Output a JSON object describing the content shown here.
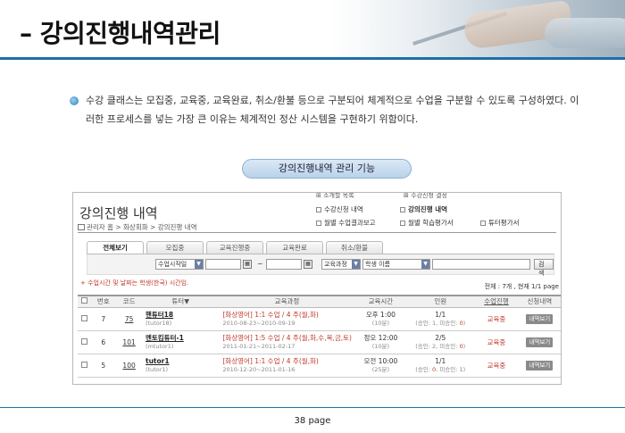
{
  "slide": {
    "title": "– 강의진행내역관리",
    "description": "수강 클래스는 모집중, 교육중, 교육완료, 취소/환불 등으로 구분되어 체계적으로 수업을 구분할 수 있도록 구성하였다. 이러한 프로세스를 넣는 가장 큰 이유는 체계적인 정산 시스템을 구현하기 위함이다.",
    "pill_label": "강의진행내역 관리 기능",
    "page_label": "38 page"
  },
  "app": {
    "menu_top": [
      "소개할 목록",
      "수강신청 결정"
    ],
    "menu": [
      {
        "label": "수강신청 내역"
      },
      {
        "label": "강의진행 내역"
      },
      {
        "label": "월별 수업결과보고"
      },
      {
        "label": "월별 학습평가서"
      },
      {
        "label": "튜터평가서"
      }
    ],
    "title": "강의진행 내역",
    "breadcrumb": "관리자 홈 > 화상회화 > 강의진행 내역",
    "tabs": [
      "전체보기",
      "모집중",
      "교육진행중",
      "교육완료",
      "취소/환불"
    ],
    "active_tab": 0,
    "search": {
      "date_select": "수업시작일",
      "date_from": "",
      "date_to": "",
      "tilde": "~",
      "category_select": "교육과정",
      "field_select": "학생 이름",
      "keyword": "",
      "button": "검색"
    },
    "note": "+ 수업시간 및 날짜는 학생(한국) 시간임.",
    "count_text": "전체 : 7개 , 현재 1/1 page",
    "columns": [
      "번호",
      "코드",
      "튜터▼",
      "교육과정",
      "교육시간",
      "인원",
      "수업진행",
      "신청내역"
    ],
    "rows": [
      {
        "no": "7",
        "code": "75",
        "tutor": "핸튜터18",
        "tutor_id": "(tutor18)",
        "course": "[화상영어] 1:1 수업 / 4 주(월,화)",
        "period": "2010-08-23~2010-09-19",
        "time": "오후 1:00",
        "duration": "(10분)",
        "people": "1/1",
        "people_detail_pre": "(승인: 1, 미승인: ",
        "people_zero": "0",
        "people_detail_post": ")",
        "status": "교육중",
        "action": "내역보기"
      },
      {
        "no": "6",
        "code": "101",
        "tutor": "멘토킴튜터-1",
        "tutor_id": "(mtutor1)",
        "course": "[화상영어] 1:5 수업 / 4 주(월,화,수,목,금,토)",
        "period": "2011-01-21~2011-02-17",
        "time": "정오 12:00",
        "duration": "(10분)",
        "people": "2/5",
        "people_detail_pre": "(승인: 2, 미승인: ",
        "people_zero": "0",
        "people_detail_post": ")",
        "status": "교육중",
        "action": "내역보기"
      },
      {
        "no": "5",
        "code": "100",
        "tutor": "tutor1",
        "tutor_id": "(tutor1)",
        "course": "[화상영어] 1:1 수업 / 4 주(월,화)",
        "period": "2010-12-20~2011-01-16",
        "time": "오전 10:00",
        "duration": "(25분)",
        "people": "1/1",
        "people_detail_pre": "(승인: ",
        "people_zero": "0",
        "people_detail_post": ", 미승인: 1)",
        "status": "교육중",
        "action": "내역보기"
      }
    ]
  },
  "colors": {
    "accent_blue": "#1d6fa8",
    "red_text": "#c0392b"
  }
}
